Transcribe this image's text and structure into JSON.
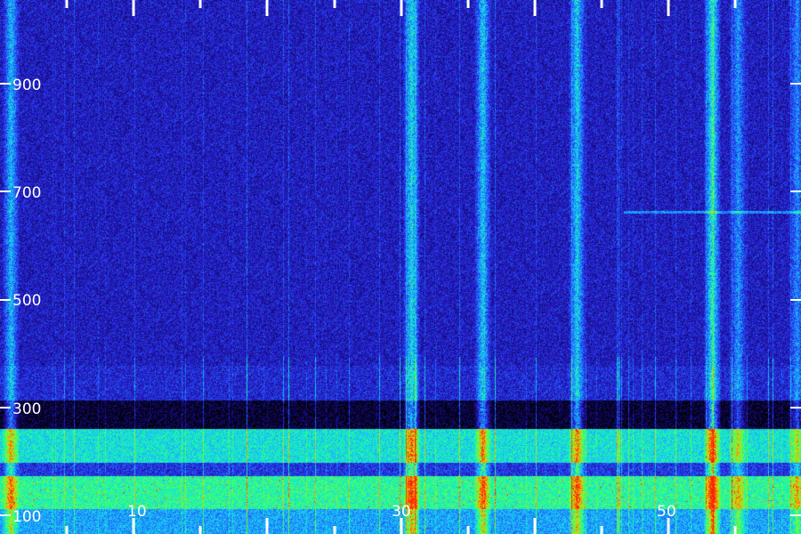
{
  "chart_data": {
    "type": "heatmap",
    "title": "",
    "xlabel": "",
    "ylabel": "",
    "y_ticks": [
      "900",
      "700",
      "500",
      "300",
      "100"
    ],
    "x_tick_labels": [
      "10",
      "30",
      "50"
    ],
    "colormap": [
      "#000000",
      "#140a7a",
      "#2a1fd6",
      "#1f6dff",
      "#19c8ff",
      "#19ff9a",
      "#7dff2a",
      "#ffb300",
      "#ff2200"
    ],
    "grid": false,
    "legend": "none",
    "vertical_bands": [
      {
        "x": 462,
        "strength": 0.85
      },
      {
        "x": 542,
        "strength": 0.75
      },
      {
        "x": 648,
        "strength": 0.8
      },
      {
        "x": 800,
        "strength": 1.0
      },
      {
        "x": 829,
        "strength": 0.55
      },
      {
        "x": 12,
        "strength": 0.7
      },
      {
        "x": 895,
        "strength": 0.5
      }
    ],
    "horizontal_bands": [
      {
        "y": 325,
        "strength": 0.9
      },
      {
        "y": 130,
        "strength": 0.95
      },
      {
        "y": 85,
        "strength": 0.6
      }
    ]
  }
}
